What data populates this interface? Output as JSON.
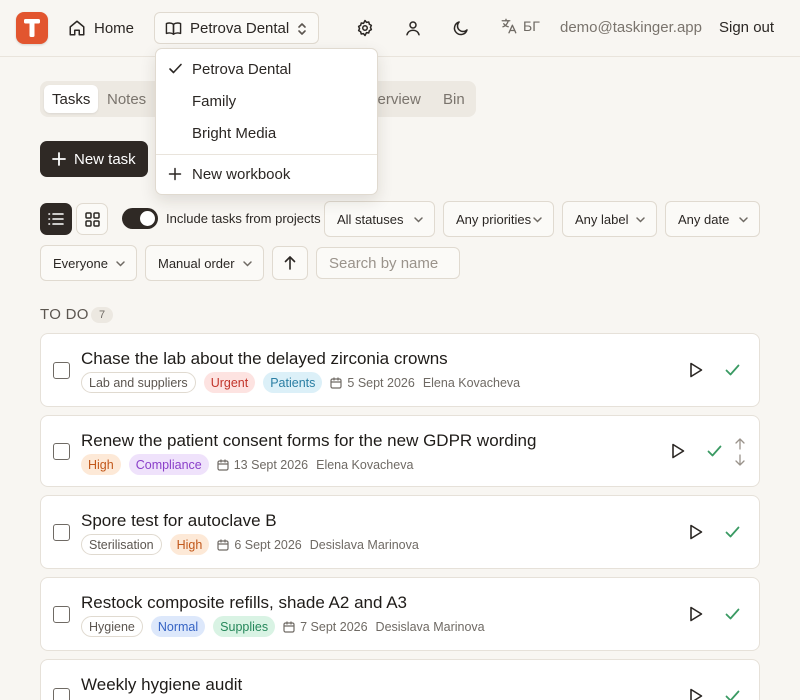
{
  "header": {
    "logo_letter": "T",
    "home_label": "Home",
    "workbook_selected": "Petrova Dental",
    "lang_label": "БГ",
    "email": "demo@taskinger.app",
    "signout_label": "Sign out"
  },
  "workbook_menu": {
    "items": [
      {
        "label": "Petrova Dental",
        "checked": true
      },
      {
        "label": "Family",
        "checked": false
      },
      {
        "label": "Bright Media",
        "checked": false
      }
    ],
    "new_label": "New workbook"
  },
  "tabs": [
    {
      "label": "Tasks",
      "active": true
    },
    {
      "label": "Notes",
      "active": false
    },
    {
      "label": "verview",
      "active": false
    },
    {
      "label": "Bin",
      "active": false
    }
  ],
  "new_task_label": "New task",
  "filters": {
    "include_projects_label": "Include tasks from projects",
    "include_projects_on": true,
    "status": "All statuses",
    "priority": "Any priorities",
    "label": "Any label",
    "date": "Any date",
    "assignee": "Everyone",
    "order": "Manual order",
    "search_placeholder": "Search by name"
  },
  "section": {
    "title": "TO DO",
    "count": "7"
  },
  "colors": {
    "accent": "#e2552f",
    "dark": "#2f2925",
    "check_green": "#3a9a63",
    "urgent_bg": "#fde3e1",
    "urgent_fg": "#c2352b",
    "high_bg": "#fde9d7",
    "high_fg": "#c2581b",
    "patients_bg": "#dcf0f8",
    "patients_fg": "#2a7ea3",
    "compliance_bg": "#efe2fb",
    "compliance_fg": "#8a3fc9",
    "normal_bg": "#dde8fb",
    "normal_fg": "#3563c4",
    "supplies_bg": "#d9f3e4",
    "supplies_fg": "#25875a"
  },
  "tasks": [
    {
      "title": "Chase the lab about the delayed zirconia crowns",
      "tags": [
        "Lab and suppliers",
        "Urgent",
        "Patients"
      ],
      "date": "5 Sept 2026",
      "assignee": "Elena Kovacheva"
    },
    {
      "title": "Renew the patient consent forms for the new GDPR wording",
      "tags": [
        "High",
        "Compliance"
      ],
      "date": "13 Sept 2026",
      "assignee": "Elena Kovacheva"
    },
    {
      "title": "Spore test for autoclave B",
      "tags": [
        "Sterilisation",
        "High"
      ],
      "date": "6 Sept 2026",
      "assignee": "Desislava Marinova"
    },
    {
      "title": "Restock composite refills, shade A2 and A3",
      "tags": [
        "Hygiene",
        "Normal",
        "Supplies"
      ],
      "date": "7 Sept 2026",
      "assignee": "Desislava Marinova"
    },
    {
      "title": "Weekly hygiene audit"
    }
  ],
  "icons": {
    "home": "home-icon",
    "book": "book-icon",
    "settings": "gear-icon",
    "user": "user-icon",
    "theme": "moon-icon",
    "language": "translate-icon",
    "play": "play-icon",
    "complete": "check-icon",
    "calendar": "calendar-icon"
  }
}
